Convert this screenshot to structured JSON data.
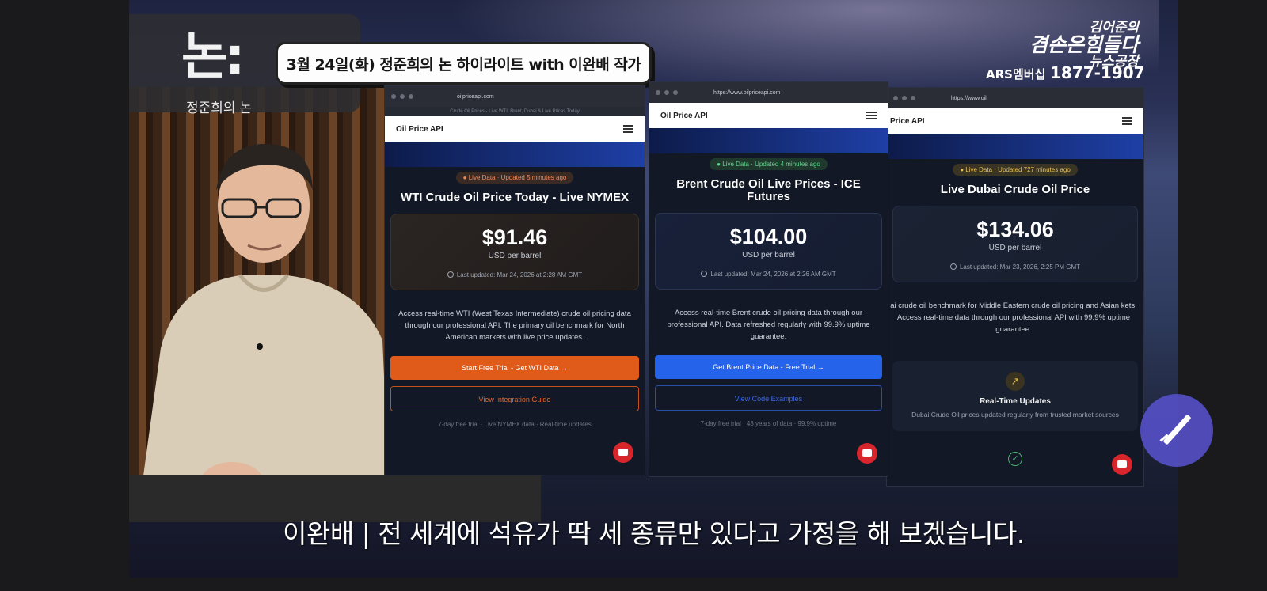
{
  "show": {
    "logo_mark": "논:",
    "logo_sub": "정준희의 논",
    "episode_title": "3월 24일(화) 정준희의 논 하이라이트 with 이완배 작가",
    "network_logo": {
      "line1": "김어준의",
      "line2": "겸손은힘들다",
      "line3": "뉴스공장"
    },
    "ars_label": "ARS멤버십",
    "ars_number": "1877-1907"
  },
  "windows": [
    {
      "url": "oilpriceapi.com",
      "tab_title": "Crude Oil Prices - Live WTI, Brent, Dubai & Live Prices Today",
      "brand": "Oil Price API",
      "badge": "● Live Data · Updated 5 minutes ago",
      "heading": "WTI Crude Oil Price Today - Live NYMEX",
      "price": "$91.46",
      "unit": "USD per barrel",
      "last_updated": "Last updated: Mar 24, 2026 at 2:28 AM GMT",
      "description": "Access real-time WTI (West Texas Intermediate) crude oil pricing data through our professional API. The primary oil benchmark for North American markets with live price updates.",
      "primary_button": "Start Free Trial - Get WTI Data →",
      "secondary_button": "View Integration Guide",
      "note": "7-day free trial · Live NYMEX data · Real-time updates"
    },
    {
      "url": "https://www.oilpriceapi.com",
      "brand": "Oil Price API",
      "badge": "● Live Data · Updated 4 minutes ago",
      "heading": "Brent Crude Oil Live Prices - ICE Futures",
      "price": "$104.00",
      "unit": "USD per barrel",
      "last_updated": "Last updated: Mar 24, 2026 at 2:26 AM GMT",
      "description": "Access real-time Brent crude oil pricing data through our professional API. Data refreshed regularly with 99.9% uptime guarantee.",
      "primary_button": "Get Brent Price Data - Free Trial →",
      "secondary_button": "View Code Examples",
      "note": "7-day free trial · 48 years of data · 99.9% uptime"
    },
    {
      "url": "https://www.oil",
      "brand": "Price API",
      "badge": "● Live Data · Updated 727 minutes ago",
      "heading": "Live Dubai Crude Oil Price",
      "price": "$134.06",
      "unit": "USD per barrel",
      "last_updated": "Last updated: Mar 23, 2026, 2:25 PM GMT",
      "description": "ai crude oil benchmark for Middle Eastern crude oil pricing and Asian kets. Access real-time data through our professional API with 99.9% uptime guarantee.",
      "feature_title": "Real-Time Updates",
      "feature_desc": "Dubai Crude Oil prices updated regularly from trusted market sources"
    }
  ],
  "subtitle": "이완배 | 전 세계에 석유가 딱 세 종류만 있다고 가정을 해 보겠습니다.",
  "colors": {
    "wti_accent": "#e05a1a",
    "brent_accent": "#2563eb",
    "pen_button": "#5550c8"
  }
}
